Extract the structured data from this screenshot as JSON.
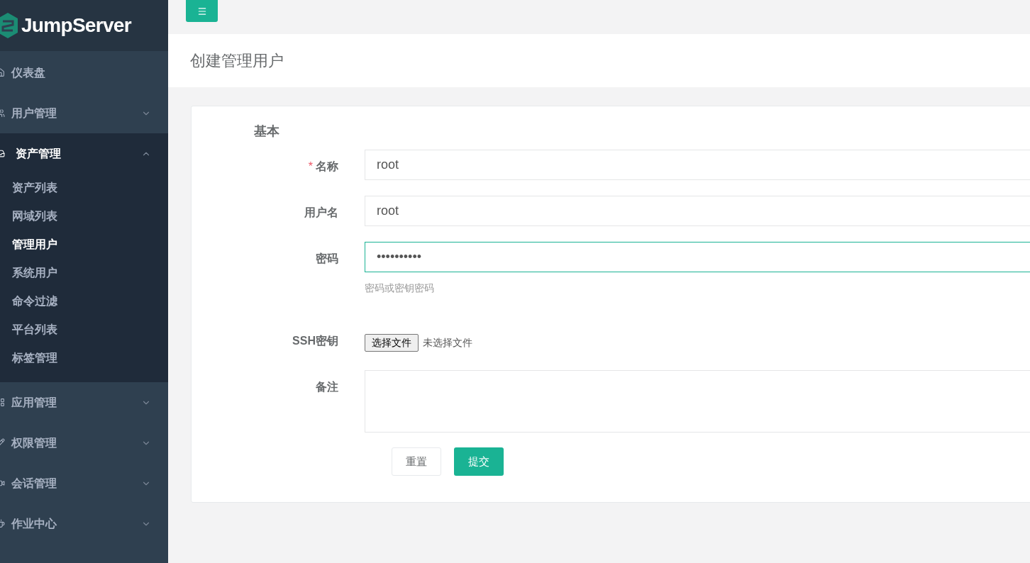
{
  "logo": {
    "text": "JumpServer"
  },
  "sidebar": {
    "items": [
      {
        "label": "仪表盘",
        "expandable": false,
        "expanded": false
      },
      {
        "label": "用户管理",
        "expandable": true,
        "expanded": false
      },
      {
        "label": "资产管理",
        "expandable": true,
        "expanded": true,
        "children": [
          {
            "label": "资产列表",
            "selected": false
          },
          {
            "label": "网域列表",
            "selected": false
          },
          {
            "label": "管理用户",
            "selected": true
          },
          {
            "label": "系统用户",
            "selected": false
          },
          {
            "label": "命令过滤",
            "selected": false
          },
          {
            "label": "平台列表",
            "selected": false
          },
          {
            "label": "标签管理",
            "selected": false
          }
        ]
      },
      {
        "label": "应用管理",
        "expandable": true,
        "expanded": false
      },
      {
        "label": "权限管理",
        "expandable": true,
        "expanded": false
      },
      {
        "label": "会话管理",
        "expandable": true,
        "expanded": false
      },
      {
        "label": "作业中心",
        "expandable": true,
        "expanded": false
      }
    ]
  },
  "page": {
    "title": "创建管理用户"
  },
  "form": {
    "section": "基本",
    "fields": [
      {
        "kind": "text",
        "label": "名称",
        "required_mark": "*",
        "value": "root",
        "focused": false
      },
      {
        "kind": "text",
        "label": "用户名",
        "value": "root",
        "focused": false
      },
      {
        "kind": "password",
        "label": "密码",
        "value": "••••••••••",
        "focused": true,
        "help": "密码或密钥密码"
      },
      {
        "kind": "file",
        "label": "SSH密钥",
        "button": "选择文件",
        "status": "未选择文件"
      },
      {
        "kind": "textarea",
        "label": "备注"
      }
    ],
    "buttons": [
      {
        "label": "重置",
        "kind": "default"
      },
      {
        "label": "提交",
        "kind": "primary"
      }
    ]
  }
}
